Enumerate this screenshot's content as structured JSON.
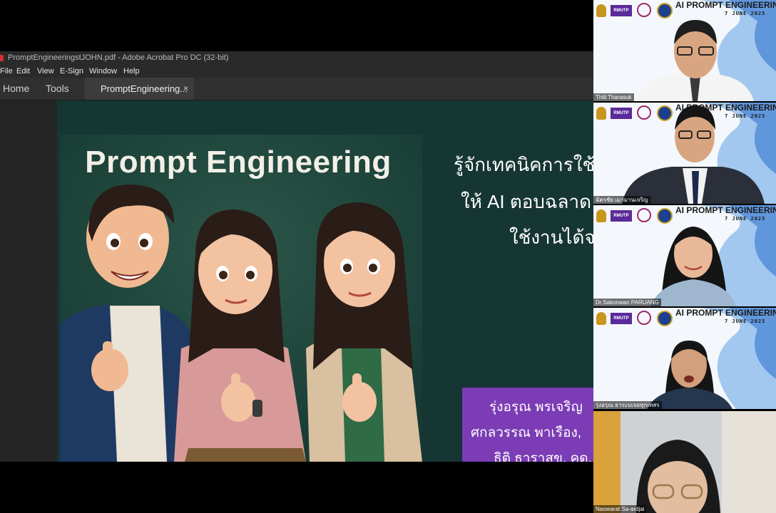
{
  "window": {
    "title": "PromptEngineeringstJOHN.pdf - Adobe Acrobat Pro DC (32-bit)",
    "accent": "#d32f2f"
  },
  "menu": [
    "File",
    "Edit",
    "View",
    "E-Sign",
    "Window",
    "Help"
  ],
  "tabs": {
    "home": "Home",
    "tools": "Tools",
    "document": "PromptEngineering...",
    "close_glyph": "×"
  },
  "slide": {
    "title": "Prompt Engineering",
    "lines": [
      "รู้จักเทคนิคการใช้",
      "ให้ AI ตอบฉลาด",
      "ใช้งานได้จ"
    ],
    "authors": [
      "รุ่งอรุณ พรเจริญ",
      "ศกลวรรณ พาเรือง,",
      "ธิติ ธาราสุข, คด."
    ],
    "background": "#163633",
    "box_color": "#7b3cb5"
  },
  "gallery": {
    "banner_title": "AI PROMPT ENGINEERING",
    "banner_date": "7 JUNE 2025",
    "logo_text": "RMUTP",
    "participants": [
      {
        "name": "Thiti Tharasuk"
      },
      {
        "name": "ฉัตรชัย เมามานเจริญ"
      },
      {
        "name": "Dr.Sakonwan PARUANG"
      },
      {
        "name": "รุ่งอรุณ ธาระบเจอทุกเทสร"
      },
      {
        "name": "Naowarat Sa-ardjai"
      }
    ]
  }
}
